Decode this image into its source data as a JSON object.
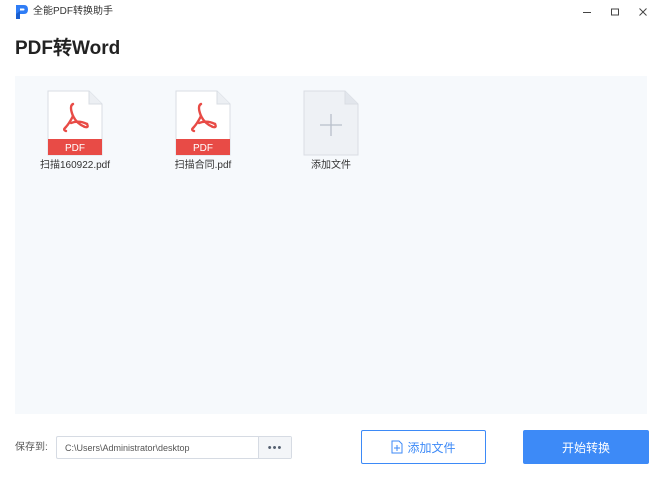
{
  "titlebar": {
    "app_title": "全能PDF转换助手",
    "icons": [
      "app-logo",
      "minimize-icon",
      "maximize-icon",
      "close-icon"
    ]
  },
  "page": {
    "title": "PDF转Word"
  },
  "files": [
    {
      "name": "扫描160922.pdf",
      "badge": "PDF",
      "icon": "pdf-file-icon"
    },
    {
      "name": "扫描合同.pdf",
      "badge": "PDF",
      "icon": "pdf-file-icon"
    }
  ],
  "add_tile": {
    "label": "添加文件",
    "icon": "plus-icon"
  },
  "bottom": {
    "save_label": "保存到:",
    "save_path": "C:\\Users\\Administrator\\desktop",
    "browse_label": "•••",
    "add_button_label": "添加文件",
    "start_button_label": "开始转换"
  },
  "colors": {
    "accent": "#3d8af7",
    "pdf_red": "#e84b46",
    "area_bg": "#f6f9fc"
  }
}
